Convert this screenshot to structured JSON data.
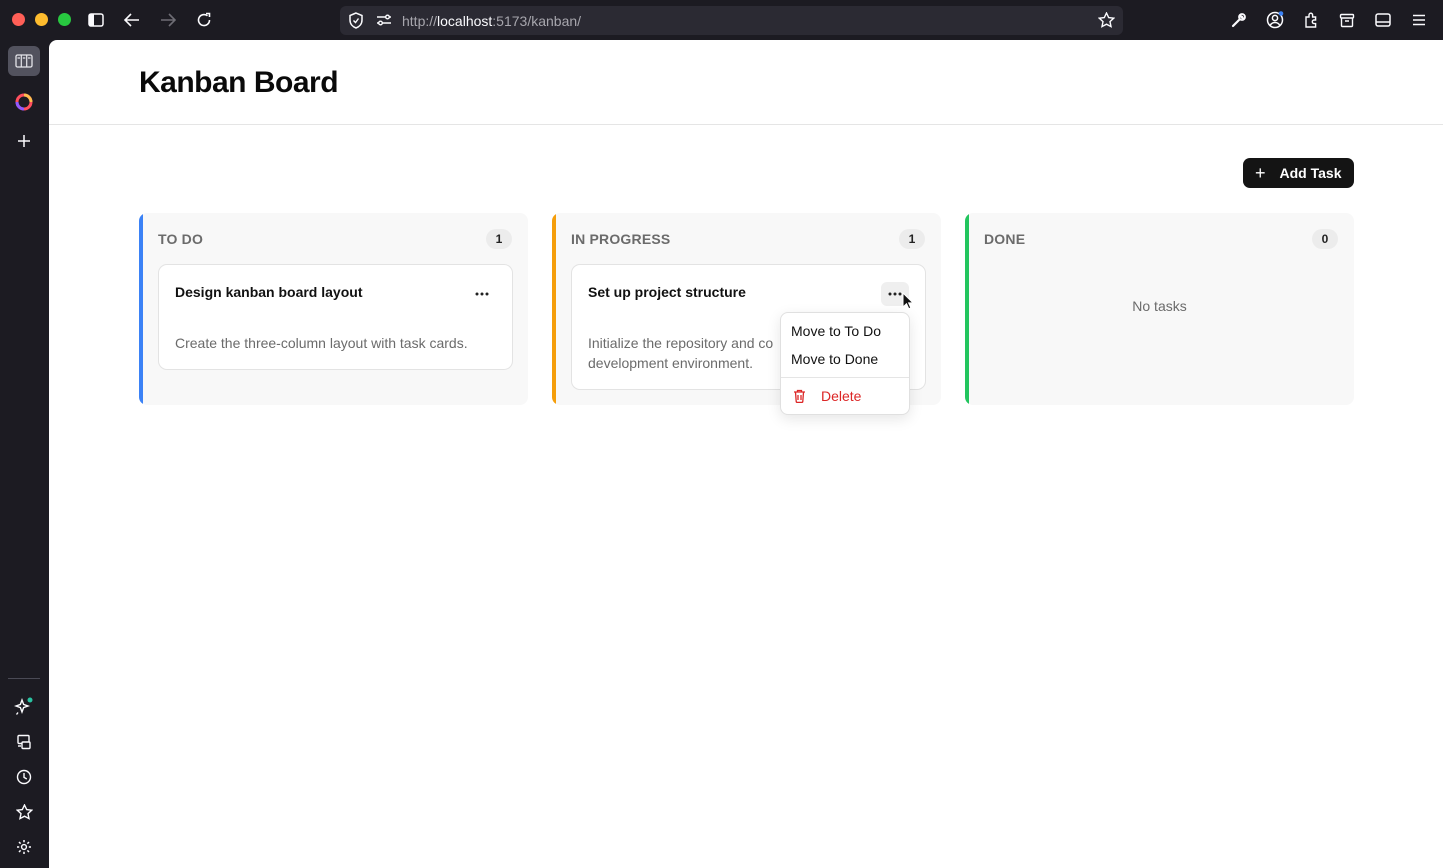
{
  "browser": {
    "url_prefix": "http://",
    "url_host": "localhost",
    "url_rest": ":5173/kanban/",
    "accent_dot": "#3b82f6"
  },
  "page": {
    "title": "Kanban Board",
    "add_task_label": "Add Task"
  },
  "columns": [
    {
      "title": "TO DO",
      "count": "1",
      "accent": "#3b82f6",
      "cards": [
        {
          "title": "Design kanban board layout",
          "description": "Create the three-column layout with task cards."
        }
      ]
    },
    {
      "title": "IN PROGRESS",
      "count": "1",
      "accent": "#f59e0b",
      "cards": [
        {
          "title": "Set up project structure",
          "description_line1": "Initialize the repository and co",
          "description_line2": "development environment."
        }
      ]
    },
    {
      "title": "DONE",
      "count": "0",
      "accent": "#22c55e",
      "empty_text": "No tasks"
    }
  ],
  "menu": {
    "move_todo": "Move to To Do",
    "move_done": "Move to Done",
    "delete": "Delete"
  }
}
